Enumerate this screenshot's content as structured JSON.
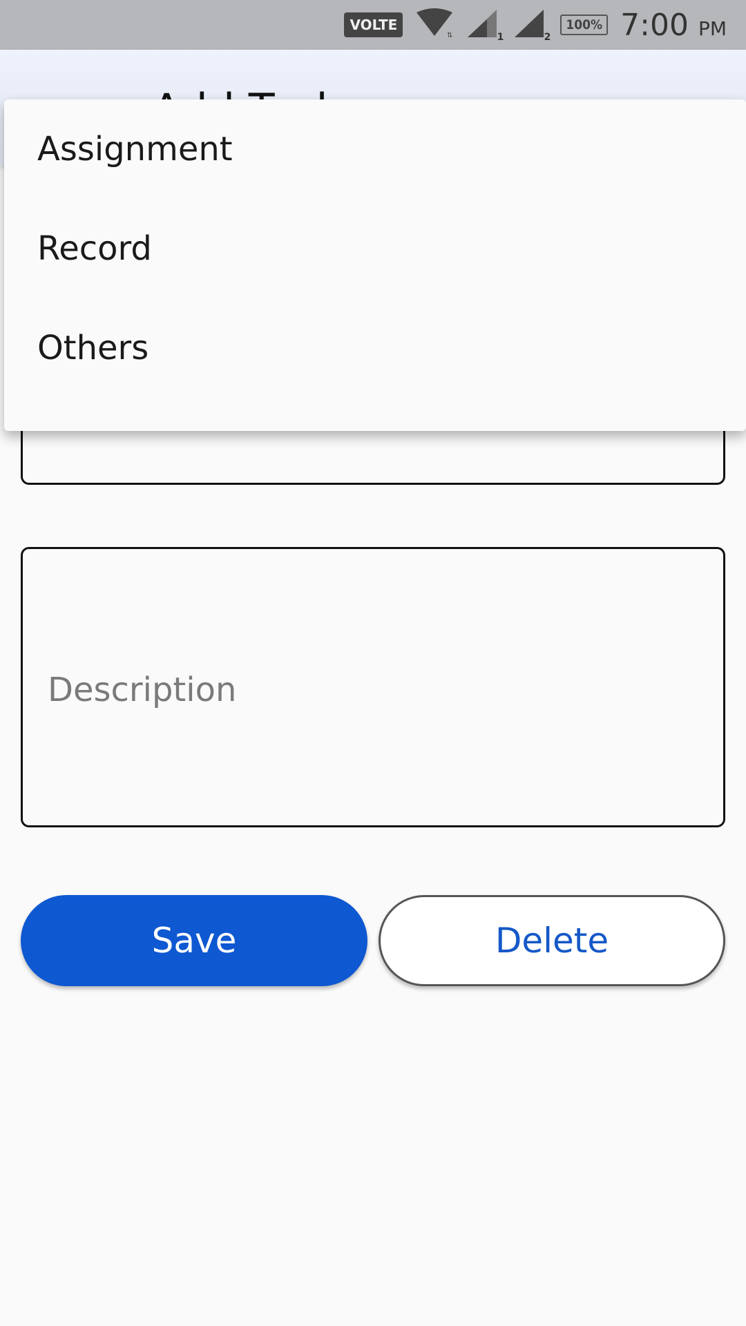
{
  "status_bar": {
    "volte": "VOLTE",
    "battery": "100%",
    "time": "7:00",
    "ampm": "PM",
    "sim1": "1",
    "sim2": "2"
  },
  "app_bar": {
    "back_icon": "arrow-back-icon",
    "title": "Add Task"
  },
  "dropdown": {
    "options": [
      "Assignment",
      "Record",
      "Others"
    ]
  },
  "form": {
    "description_placeholder": "Description"
  },
  "buttons": {
    "save": "Save",
    "delete": "Delete"
  },
  "colors": {
    "primary": "#0e58d1",
    "delete_text": "#1558c8"
  }
}
